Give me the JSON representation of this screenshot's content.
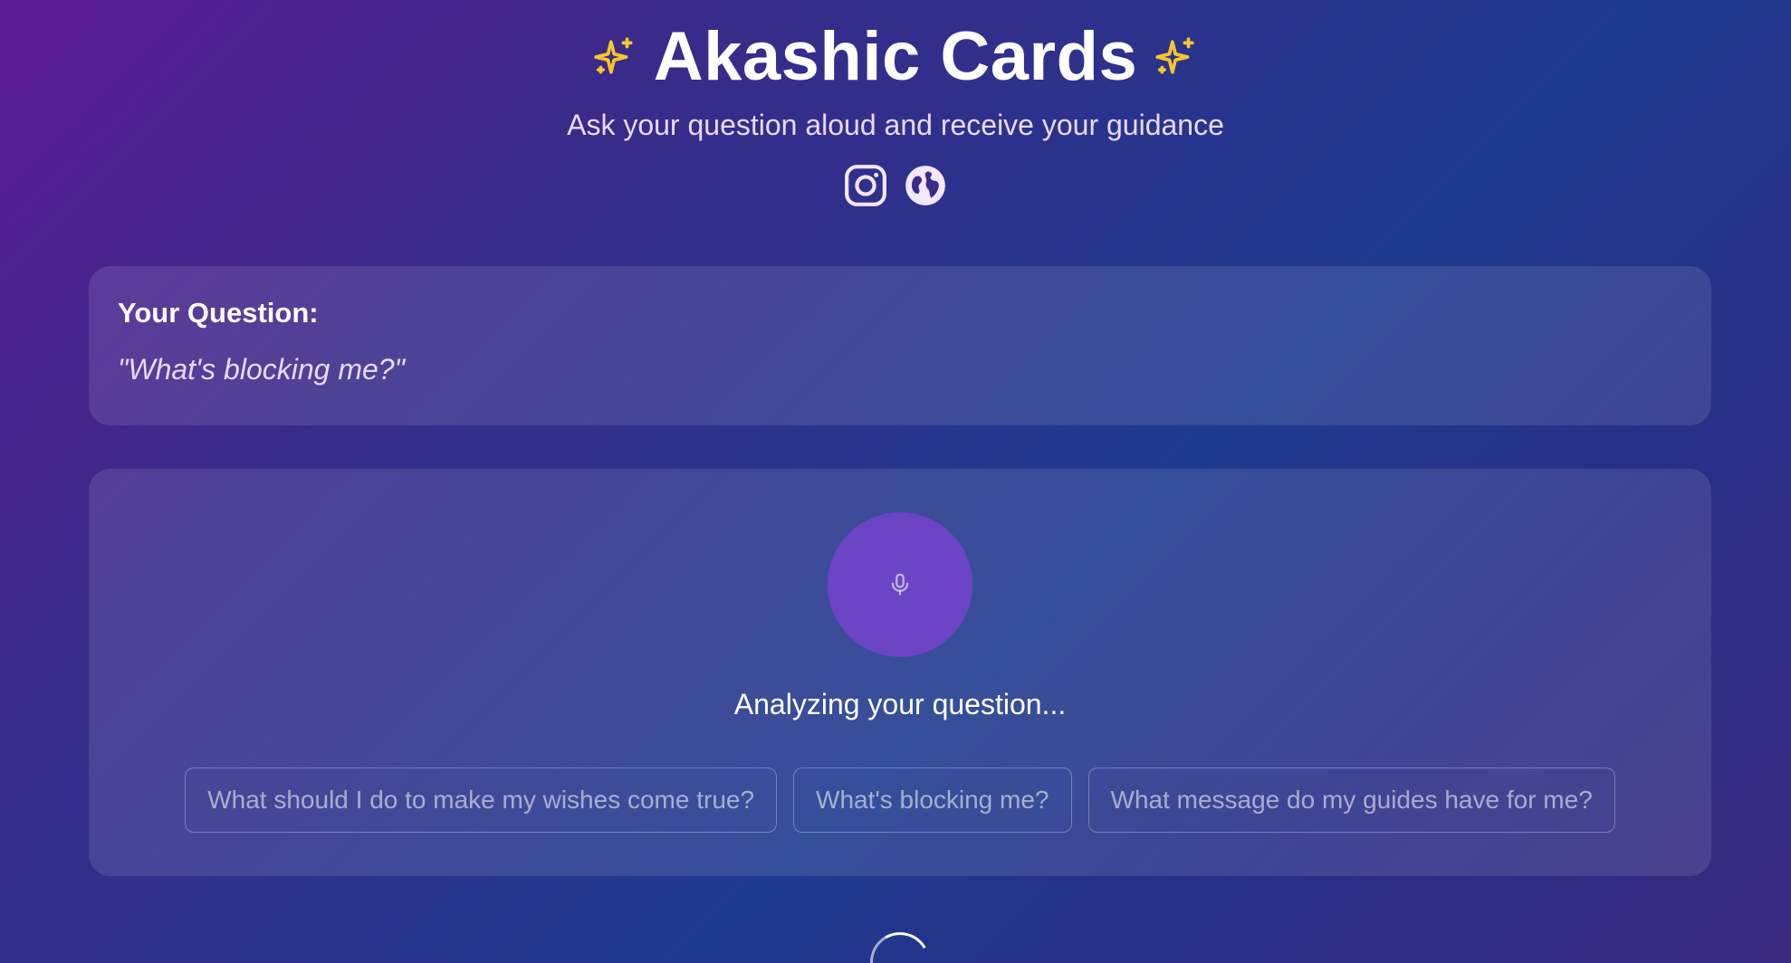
{
  "header": {
    "title": "Akashic Cards",
    "subtitle": "Ask your question aloud and receive your guidance",
    "left_icon": "sparkles-icon",
    "right_icon": "sparkles-icon",
    "socials": [
      {
        "icon": "instagram-icon"
      },
      {
        "icon": "globe-icon"
      }
    ]
  },
  "question": {
    "label": "Your Question:",
    "text": "\"What's blocking me?\""
  },
  "voice": {
    "mic_icon": "microphone-icon",
    "status": "Analyzing your question...",
    "suggestions": [
      "What should I do to make my wishes come true?",
      "What's blocking me?",
      "What message do my guides have for me?"
    ]
  },
  "colors": {
    "accent": "#6b45c6",
    "sparkle": "#f6c52b"
  }
}
